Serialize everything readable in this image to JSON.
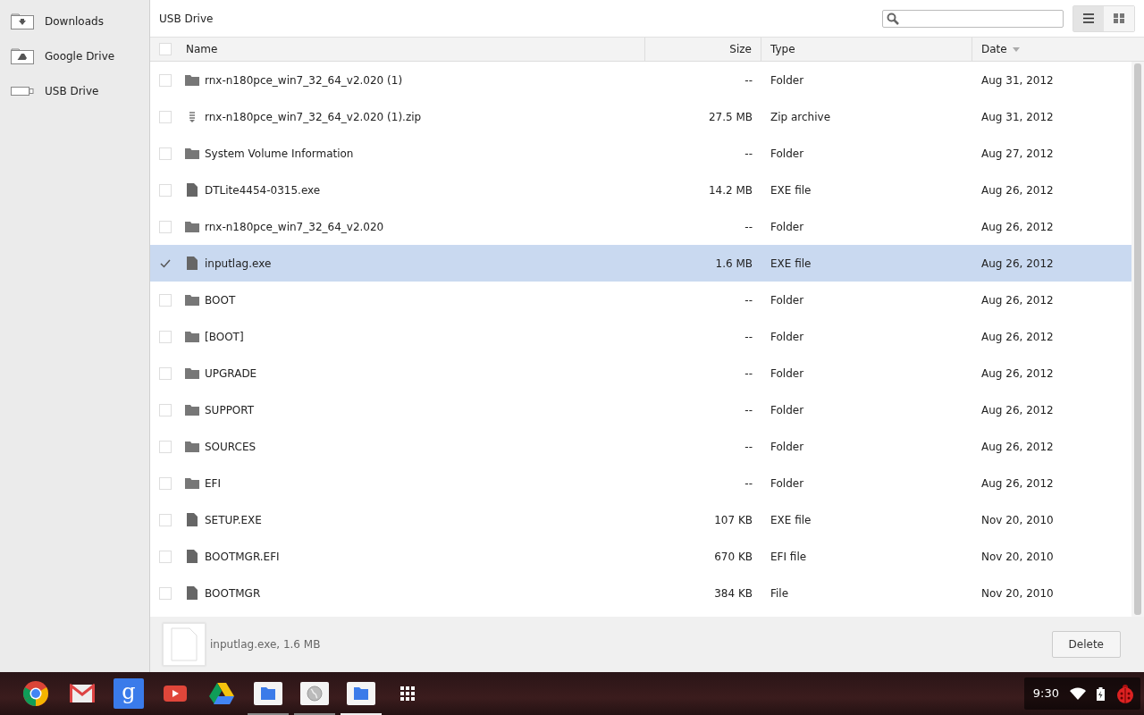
{
  "sidebar": {
    "items": [
      {
        "label": "Downloads",
        "kind": "downloads"
      },
      {
        "label": "Google Drive",
        "kind": "drive"
      },
      {
        "label": "USB Drive",
        "kind": "usb"
      }
    ]
  },
  "header": {
    "title": "USB Drive",
    "view_toggle": [
      {
        "kind": "list",
        "selected": true
      },
      {
        "kind": "grid",
        "selected": false
      }
    ]
  },
  "table": {
    "select_all": {
      "checked": false
    },
    "columns": [
      {
        "label": "Name",
        "sorted": false
      },
      {
        "label": "Size",
        "sorted": false
      },
      {
        "label": "Type",
        "sorted": false
      },
      {
        "label": "Date",
        "sorted": true
      }
    ],
    "rows": [
      {
        "kind": "folder",
        "name": "rnx-n180pce_win7_32_64_v2.020 (1)",
        "size": "--",
        "type": "Folder",
        "date": "Aug 31, 2012",
        "selected": false
      },
      {
        "kind": "zip",
        "name": "rnx-n180pce_win7_32_64_v2.020 (1).zip",
        "size": "27.5 MB",
        "type": "Zip archive",
        "date": "Aug 31, 2012",
        "selected": false
      },
      {
        "kind": "folder",
        "name": "System Volume Information",
        "size": "--",
        "type": "Folder",
        "date": "Aug 27, 2012",
        "selected": false
      },
      {
        "kind": "file",
        "name": "DTLite4454-0315.exe",
        "size": "14.2 MB",
        "type": "EXE file",
        "date": "Aug 26, 2012",
        "selected": false
      },
      {
        "kind": "folder",
        "name": "rnx-n180pce_win7_32_64_v2.020",
        "size": "--",
        "type": "Folder",
        "date": "Aug 26, 2012",
        "selected": false
      },
      {
        "kind": "file",
        "name": "inputlag.exe",
        "size": "1.6 MB",
        "type": "EXE file",
        "date": "Aug 26, 2012",
        "selected": true
      },
      {
        "kind": "folder",
        "name": "BOOT",
        "size": "--",
        "type": "Folder",
        "date": "Aug 26, 2012",
        "selected": false
      },
      {
        "kind": "folder",
        "name": "[BOOT]",
        "size": "--",
        "type": "Folder",
        "date": "Aug 26, 2012",
        "selected": false
      },
      {
        "kind": "folder",
        "name": "UPGRADE",
        "size": "--",
        "type": "Folder",
        "date": "Aug 26, 2012",
        "selected": false
      },
      {
        "kind": "folder",
        "name": "SUPPORT",
        "size": "--",
        "type": "Folder",
        "date": "Aug 26, 2012",
        "selected": false
      },
      {
        "kind": "folder",
        "name": "SOURCES",
        "size": "--",
        "type": "Folder",
        "date": "Aug 26, 2012",
        "selected": false
      },
      {
        "kind": "folder",
        "name": "EFI",
        "size": "--",
        "type": "Folder",
        "date": "Aug 26, 2012",
        "selected": false
      },
      {
        "kind": "file",
        "name": "SETUP.EXE",
        "size": "107 KB",
        "type": "EXE file",
        "date": "Nov 20, 2010",
        "selected": false
      },
      {
        "kind": "file",
        "name": "BOOTMGR.EFI",
        "size": "670 KB",
        "type": "EFI file",
        "date": "Nov 20, 2010",
        "selected": false
      },
      {
        "kind": "file",
        "name": "BOOTMGR",
        "size": "384 KB",
        "type": "File",
        "date": "Nov 20, 2010",
        "selected": false
      }
    ]
  },
  "preview_bar": {
    "summary": "inputlag.exe, 1.6 MB",
    "button": "Delete"
  },
  "shelf": {
    "apps": [
      {
        "kind": "chrome",
        "running": false,
        "active": false
      },
      {
        "kind": "gmail",
        "running": false,
        "active": false
      },
      {
        "kind": "google",
        "glyph": "g",
        "running": false,
        "active": false
      },
      {
        "kind": "youtube",
        "running": false,
        "active": false
      },
      {
        "kind": "drive",
        "running": false,
        "active": false
      },
      {
        "kind": "files",
        "running": true,
        "active": false
      },
      {
        "kind": "globe",
        "running": true,
        "active": false
      },
      {
        "kind": "files",
        "running": true,
        "active": true
      },
      {
        "kind": "launcher",
        "running": false,
        "active": false
      }
    ],
    "tray": {
      "time": "9:30"
    }
  }
}
